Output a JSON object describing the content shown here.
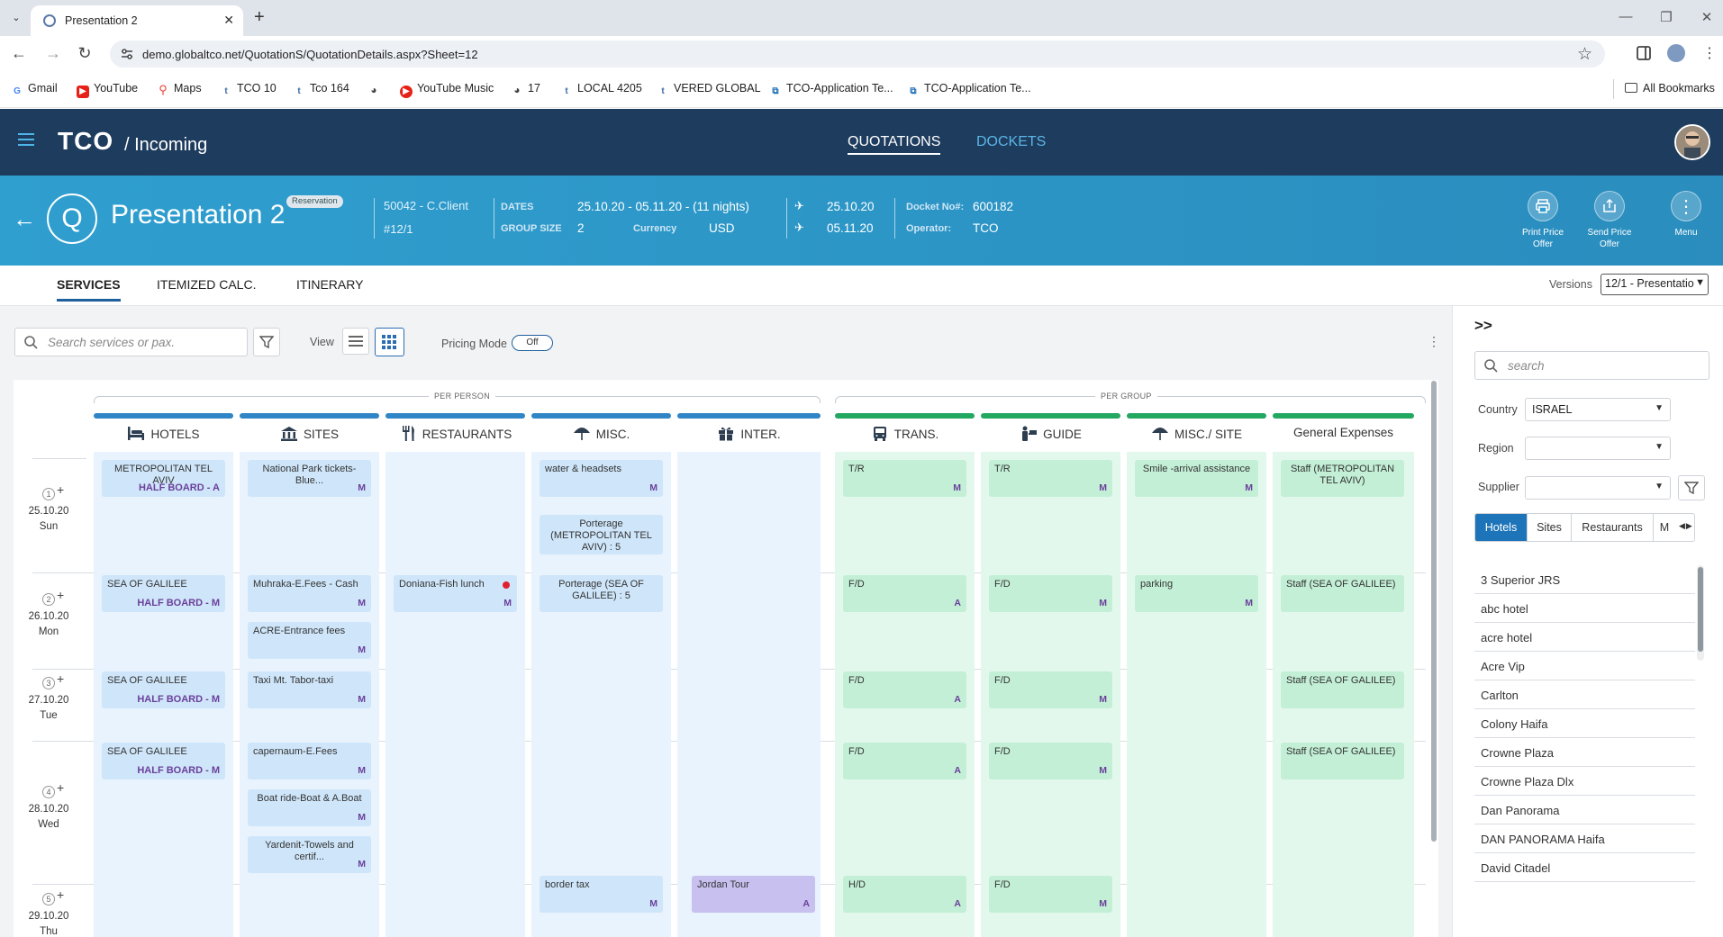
{
  "browser": {
    "tab_title": "Presentation 2",
    "url": "demo.globaltco.net/QuotationS/QuotationDetails.aspx?Sheet=12",
    "bookmarks": [
      "Gmail",
      "YouTube",
      "Maps",
      "TCO 10",
      "Tco 164",
      "",
      "YouTube Music",
      "17",
      "LOCAL 4205",
      "VERED GLOBAL",
      "TCO-Application Te...",
      "TCO-Application Te..."
    ],
    "all_bookmarks": "All Bookmarks"
  },
  "app": {
    "brand": "TCO",
    "section": "/ Incoming",
    "nav": [
      "QUOTATIONS",
      "DOCKETS"
    ],
    "accent": "#2f9fcf",
    "header_bg": "#1e3c5e"
  },
  "banner": {
    "q_letter": "Q",
    "title": "Presentation 2",
    "badge": "Reservation",
    "client": "50042 - C.Client",
    "quote_no": "#12/1",
    "dates_label": "DATES",
    "dates": "25.10.20 - 05.11.20 - (11 nights)",
    "group_size_label": "GROUP SIZE",
    "group_size": "2",
    "currency_label": "Currency",
    "currency": "USD",
    "depart": "25.10.20",
    "return": "05.11.20",
    "docket_label": "Docket No#:",
    "docket": "600182",
    "operator_label": "Operator:",
    "operator": "TCO",
    "actions": [
      {
        "label": "Print Price Offer",
        "icon": "printer-icon"
      },
      {
        "label": "Send Price Offer",
        "icon": "share-icon"
      },
      {
        "label": "Menu",
        "icon": "kebab-icon"
      }
    ]
  },
  "tabs": [
    "SERVICES",
    "ITEMIZED CALC.",
    "ITINERARY"
  ],
  "versions": {
    "label": "Versions",
    "selected": "12/1 - Presentatio"
  },
  "toolbar": {
    "search_placeholder": "Search services or pax.",
    "view_label": "View",
    "pricing_label": "Pricing Mode",
    "pricing_state": "Off"
  },
  "grid": {
    "per_person_label": "PER PERSON",
    "per_group_label": "PER GROUP",
    "columns": [
      "HOTELS",
      "SITES",
      "RESTAURANTS",
      "MISC.",
      "INTER.",
      "TRANS.",
      "GUIDE",
      "MISC./ SITE",
      "General Expenses"
    ],
    "days": [
      {
        "num": "1",
        "date": "25.10.20",
        "dow": "Sun"
      },
      {
        "num": "2",
        "date": "26.10.20",
        "dow": "Mon"
      },
      {
        "num": "3",
        "date": "27.10.20",
        "dow": "Tue"
      },
      {
        "num": "4",
        "date": "28.10.20",
        "dow": "Wed"
      },
      {
        "num": "5",
        "date": "29.10.20",
        "dow": "Thu"
      }
    ],
    "cards": {
      "h1": "METROPOLITAN TEL AVIV",
      "h1s": "HALF BOARD - A",
      "h2": "SEA OF GALILEE",
      "h2s": "HALF BOARD - M",
      "h3": "SEA OF GALILEE",
      "h3s": "HALF BOARD - M",
      "h4": "SEA OF GALILEE",
      "h4s": "HALF BOARD - M",
      "s1": "National Park tickets-Blue...",
      "s2a": "Muhraka-E.Fees - Cash",
      "s2b": "ACRE-Entrance fees",
      "s3": "Taxi Mt. Tabor-taxi",
      "s4a": "capernaum-E.Fees",
      "s4b": "Boat ride-Boat & A.Boat",
      "s4c": "Yardenit-Towels and certif...",
      "r2": "Doniana-Fish lunch",
      "m1a": "water & headsets",
      "m1b": "Porterage (METROPOLITAN TEL AVIV) : 5",
      "m2": "Porterage (SEA OF GALILEE) : 5",
      "m5": "border tax",
      "i5": "Jordan Tour",
      "t1": "T/R",
      "t2": "F/D",
      "t3": "F/D",
      "t4": "F/D",
      "t5": "H/D",
      "g1": "T/R",
      "g2": "F/D",
      "g3": "F/D",
      "g4": "F/D",
      "g5": "F/D",
      "ms1": "Smile -arrival assistance",
      "ms2": "parking",
      "ge1": "Staff (METROPOLITAN TEL AVIV)",
      "ge2": "Staff (SEA OF GALILEE)",
      "ge3": "Staff (SEA OF GALILEE)",
      "ge4": "Staff (SEA OF GALILEE)",
      "tagM": "M",
      "tagA": "A"
    }
  },
  "right_panel": {
    "toggle": ">>",
    "search_placeholder": "search",
    "country_label": "Country",
    "country": "ISRAEL",
    "region_label": "Region",
    "region": "",
    "supplier_label": "Supplier",
    "supplier": "",
    "tabs": [
      "Hotels",
      "Sites",
      "Restaurants",
      "M"
    ],
    "hotels": [
      "3 Superior JRS",
      "abc hotel",
      "acre hotel",
      "Acre Vip",
      "Carlton",
      "Colony Haifa",
      "Crowne Plaza",
      "Crowne Plaza Dlx",
      "Dan Panorama",
      "DAN PANORAMA Haifa",
      "David Citadel"
    ]
  }
}
